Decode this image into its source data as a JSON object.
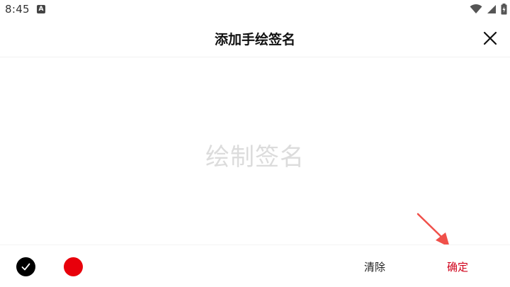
{
  "status_bar": {
    "time": "8:45",
    "app_icon_letter": "A",
    "icons": [
      "wifi-icon",
      "signal-icon",
      "battery-icon"
    ]
  },
  "header": {
    "title": "添加手绘签名",
    "close_icon": "close-icon"
  },
  "canvas": {
    "placeholder": "绘制签名"
  },
  "toolbar": {
    "colors": [
      {
        "name": "black",
        "hex": "#000000",
        "selected": true
      },
      {
        "name": "red",
        "hex": "#e8000b",
        "selected": false
      }
    ],
    "clear_label": "清除",
    "confirm_label": "确定"
  },
  "colors": {
    "accent": "#d0021b",
    "annotation_arrow": "#f0504a",
    "placeholder": "#dcdcdc"
  }
}
